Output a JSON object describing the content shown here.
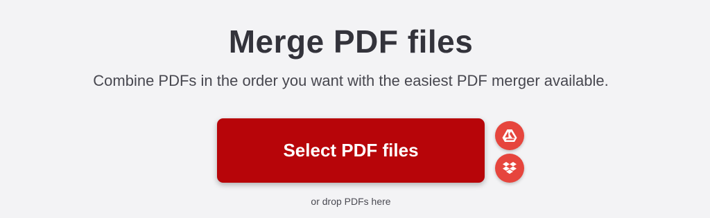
{
  "header": {
    "title": "Merge PDF files",
    "subtitle": "Combine PDFs in the order you want with the easiest PDF merger available."
  },
  "upload": {
    "select_label": "Select PDF files",
    "drop_hint": "or drop PDFs here",
    "cloud_sources": [
      {
        "icon": "google-drive-icon"
      },
      {
        "icon": "dropbox-icon"
      }
    ]
  },
  "colors": {
    "primary_button": "#b70509",
    "cloud_button": "#e6453d",
    "background": "#f3f3f5",
    "title_text": "#33333b"
  }
}
